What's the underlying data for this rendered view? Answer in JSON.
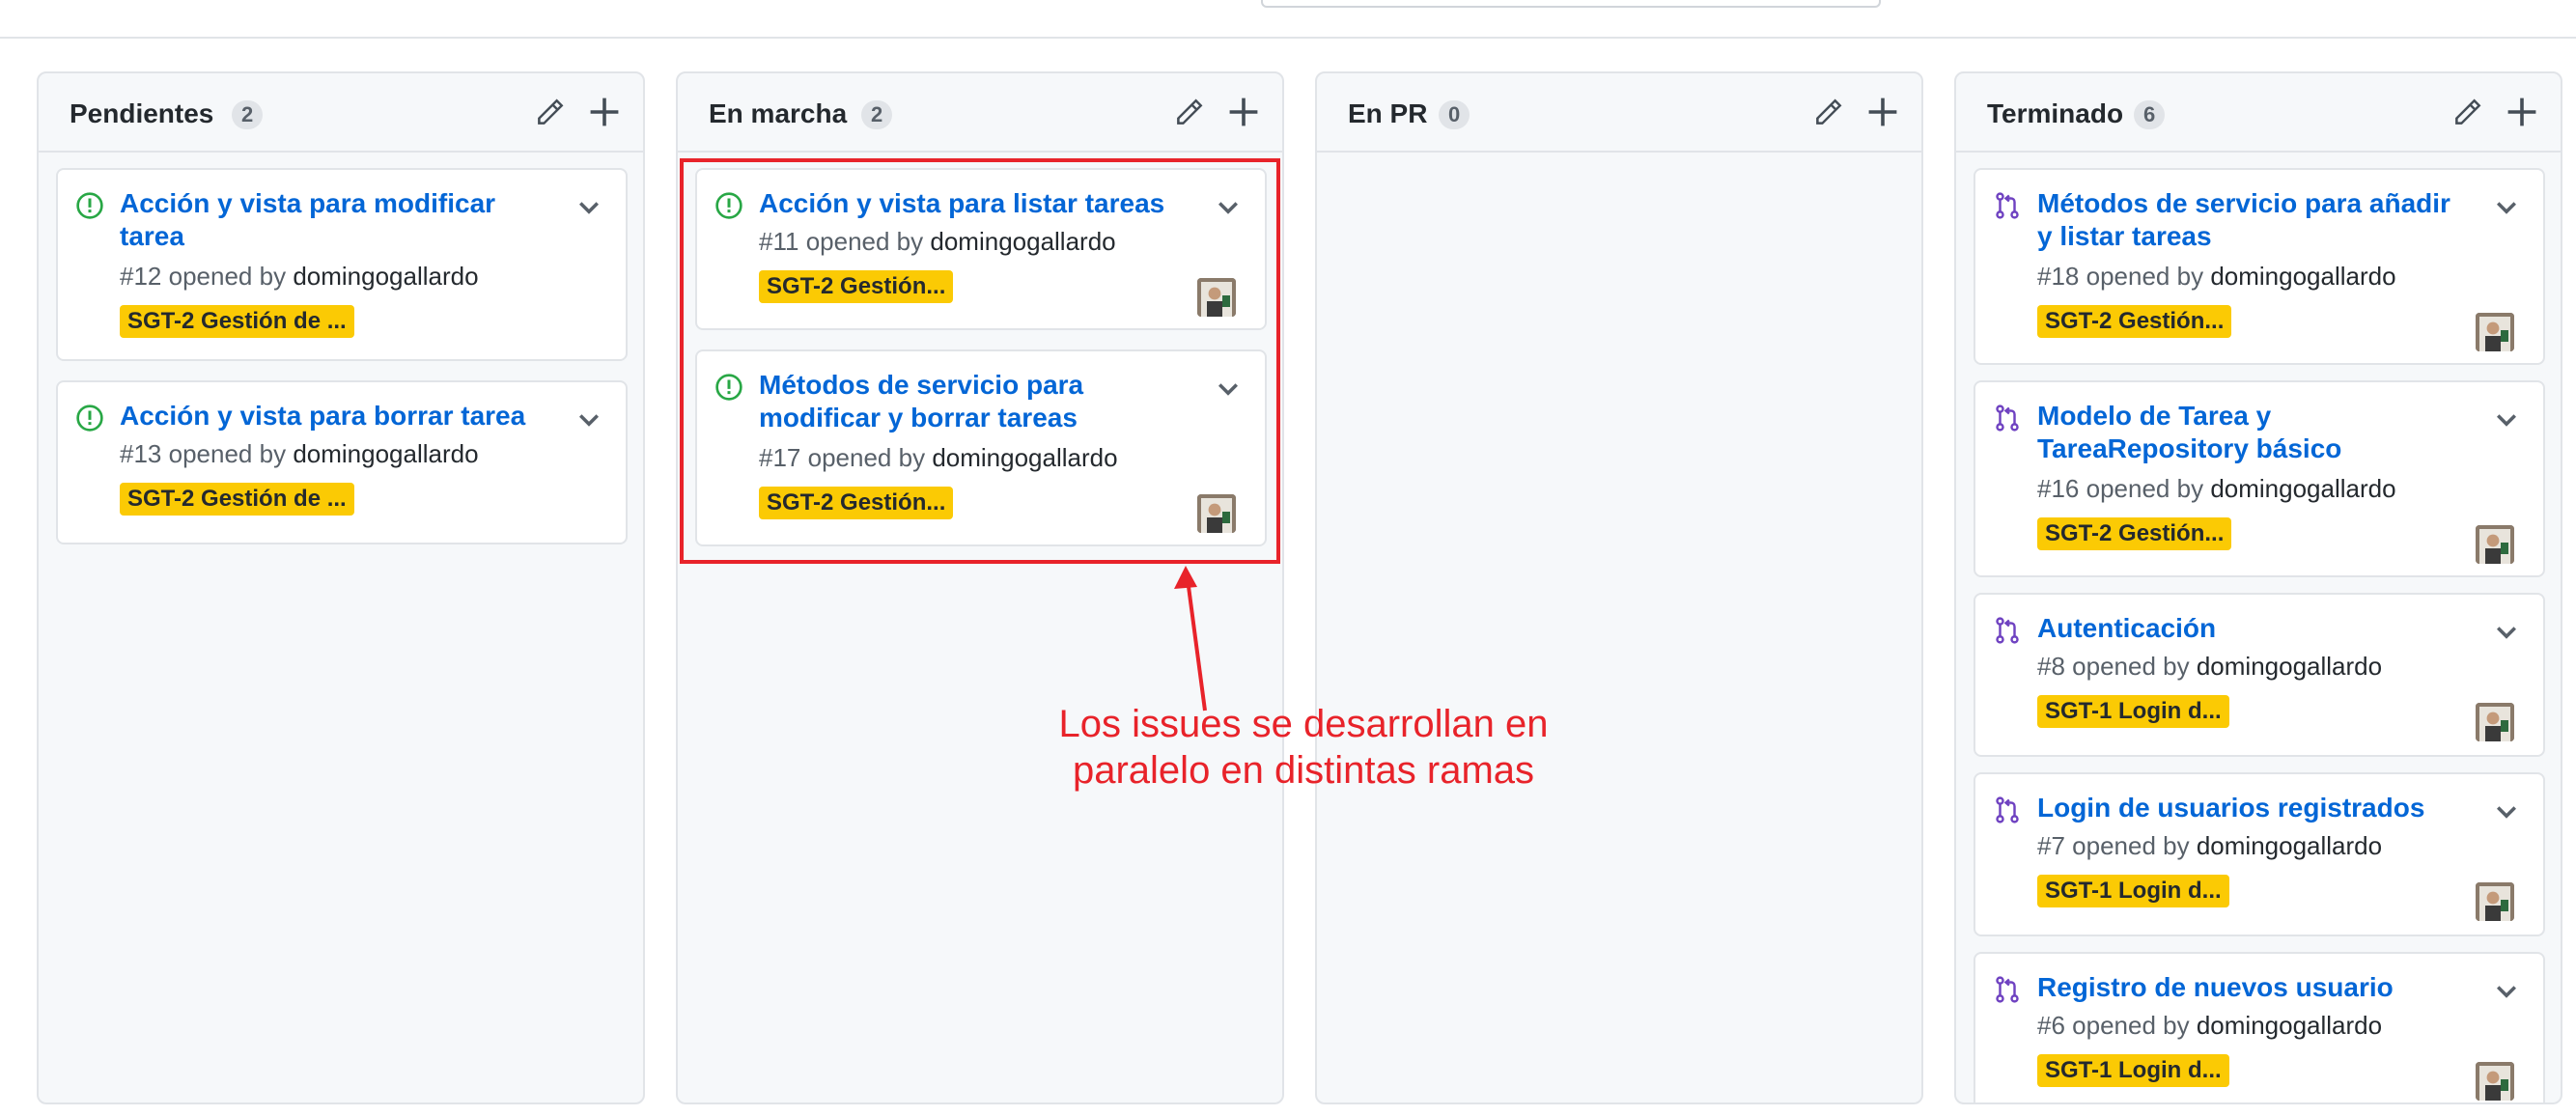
{
  "colors": {
    "link": "#0366d6",
    "open_issue": "#28a745",
    "pull_request": "#6f42c1",
    "label": "#fbca04",
    "annotation": "#e8232a"
  },
  "columns": [
    {
      "title": "Pendientes",
      "count": "2",
      "cards": [
        {
          "type": "issue",
          "title": "Acción y vista para modificar tarea",
          "number": "#12",
          "opened_by": "opened by",
          "author": "domingogallardo",
          "label": "SGT-2 Gestión de ...",
          "avatar": false
        },
        {
          "type": "issue",
          "title": "Acción y vista para borrar tarea",
          "number": "#13",
          "opened_by": "opened by",
          "author": "domingogallardo",
          "label": "SGT-2 Gestión de ...",
          "avatar": false
        }
      ]
    },
    {
      "title": "En marcha",
      "count": "2",
      "cards": [
        {
          "type": "issue",
          "title": "Acción y vista para listar tareas",
          "number": "#11",
          "opened_by": "opened by",
          "author": "domingogallardo",
          "label": "SGT-2 Gestión...",
          "avatar": true
        },
        {
          "type": "issue",
          "title": "Métodos de servicio para modificar y borrar tareas",
          "number": "#17",
          "opened_by": "opened by",
          "author": "domingogallardo",
          "label": "SGT-2 Gestión...",
          "avatar": true
        }
      ]
    },
    {
      "title": "En PR",
      "count": "0",
      "cards": []
    },
    {
      "title": "Terminado",
      "count": "6",
      "cards": [
        {
          "type": "pr",
          "title": "Métodos de servicio para añadir y listar tareas",
          "number": "#18",
          "opened_by": "opened by",
          "author": "domingogallardo",
          "label": "SGT-2 Gestión...",
          "avatar": true
        },
        {
          "type": "pr",
          "title": "Modelo de Tarea y TareaRepository básico",
          "number": "#16",
          "opened_by": "opened by",
          "author": "domingogallardo",
          "label": "SGT-2 Gestión...",
          "avatar": true
        },
        {
          "type": "pr",
          "title": "Autenticación",
          "number": "#8",
          "opened_by": "opened by",
          "author": "domingogallardo",
          "label": "SGT-1 Login d...",
          "avatar": true
        },
        {
          "type": "pr",
          "title": "Login de usuarios registrados",
          "number": "#7",
          "opened_by": "opened by",
          "author": "domingogallardo",
          "label": "SGT-1 Login d...",
          "avatar": true
        },
        {
          "type": "pr",
          "title": "Registro de nuevos usuario",
          "number": "#6",
          "opened_by": "opened by",
          "author": "domingogallardo",
          "label": "SGT-1 Login d...",
          "avatar": true
        }
      ]
    }
  ],
  "annotation": {
    "text_line1": "Los issues se desarrollan en",
    "text_line2": "paralelo en distintas ramas"
  }
}
